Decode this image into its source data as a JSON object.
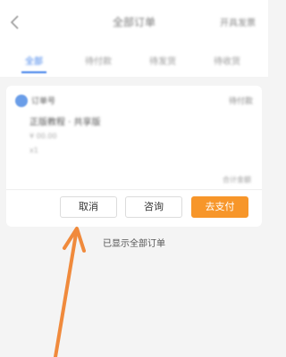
{
  "header": {
    "title": "全部订单",
    "right_action": "开具发票"
  },
  "tabs": [
    {
      "label": "全部"
    },
    {
      "label": "待付款"
    },
    {
      "label": "待发货"
    },
    {
      "label": "待收货"
    }
  ],
  "order": {
    "store_name": "订单号",
    "status": "待付款",
    "item_line1": "正版教程 · 共享版",
    "item_line2": "¥ 00.00",
    "item_line3": "x1",
    "total_text": "合计金额"
  },
  "actions": {
    "cancel_label": "取消",
    "consult_label": "咨询",
    "pay_label": "去支付"
  },
  "footer": {
    "note": "已显示全部订单"
  },
  "colors": {
    "accent_blue": "#3b7de9",
    "pay_orange": "#f7962a",
    "arrow_orange": "#f08a3c"
  }
}
